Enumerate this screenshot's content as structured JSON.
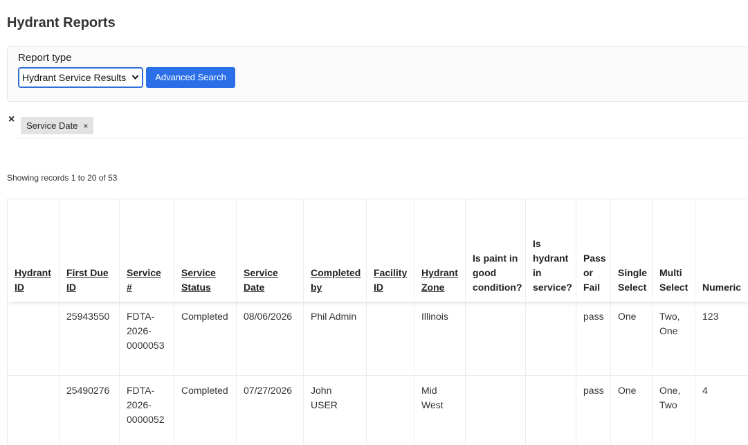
{
  "page": {
    "title": "Hydrant Reports"
  },
  "report": {
    "label": "Report type",
    "selected": "Hydrant Service Results",
    "advanced_search": "Advanced Search"
  },
  "filters": {
    "clear_symbol": "×",
    "chips": [
      {
        "label": "Service Date",
        "remove": "×"
      }
    ]
  },
  "records": {
    "summary": "Showing records 1 to 20 of 53"
  },
  "table": {
    "columns": [
      {
        "label": "Hydrant ID",
        "sortable": true
      },
      {
        "label": "First Due ID",
        "sortable": true
      },
      {
        "label": "Service #",
        "sortable": true
      },
      {
        "label": "Service Status",
        "sortable": true
      },
      {
        "label": "Service Date",
        "sortable": true
      },
      {
        "label": "Completed by",
        "sortable": true
      },
      {
        "label": "Facility ID",
        "sortable": true
      },
      {
        "label": "Hydrant Zone",
        "sortable": true
      },
      {
        "label": "Is paint in good condition?",
        "sortable": false
      },
      {
        "label": "Is hydrant in service?",
        "sortable": false
      },
      {
        "label": "Pass or Fail",
        "sortable": false
      },
      {
        "label": "Single Select",
        "sortable": false
      },
      {
        "label": "Multi Select",
        "sortable": false
      },
      {
        "label": "Numeric",
        "sortable": false
      }
    ],
    "rows": [
      [
        "",
        "25943550",
        "FDTA-2026-0000053",
        "Completed",
        "08/06/2026",
        "Phil Admin",
        "",
        "Illinois",
        "",
        "",
        "pass",
        "One",
        "Two, One",
        "123"
      ],
      [
        "",
        "25490276",
        "FDTA-2026-0000052",
        "Completed",
        "07/27/2026",
        "John USER",
        "",
        "Mid West",
        "",
        "",
        "pass",
        "One",
        "One, Two",
        "4"
      ]
    ]
  },
  "colors": {
    "primary": "#2a6fe8",
    "select_border": "#2f6fd6",
    "chip_bg": "#e3e3e3"
  }
}
